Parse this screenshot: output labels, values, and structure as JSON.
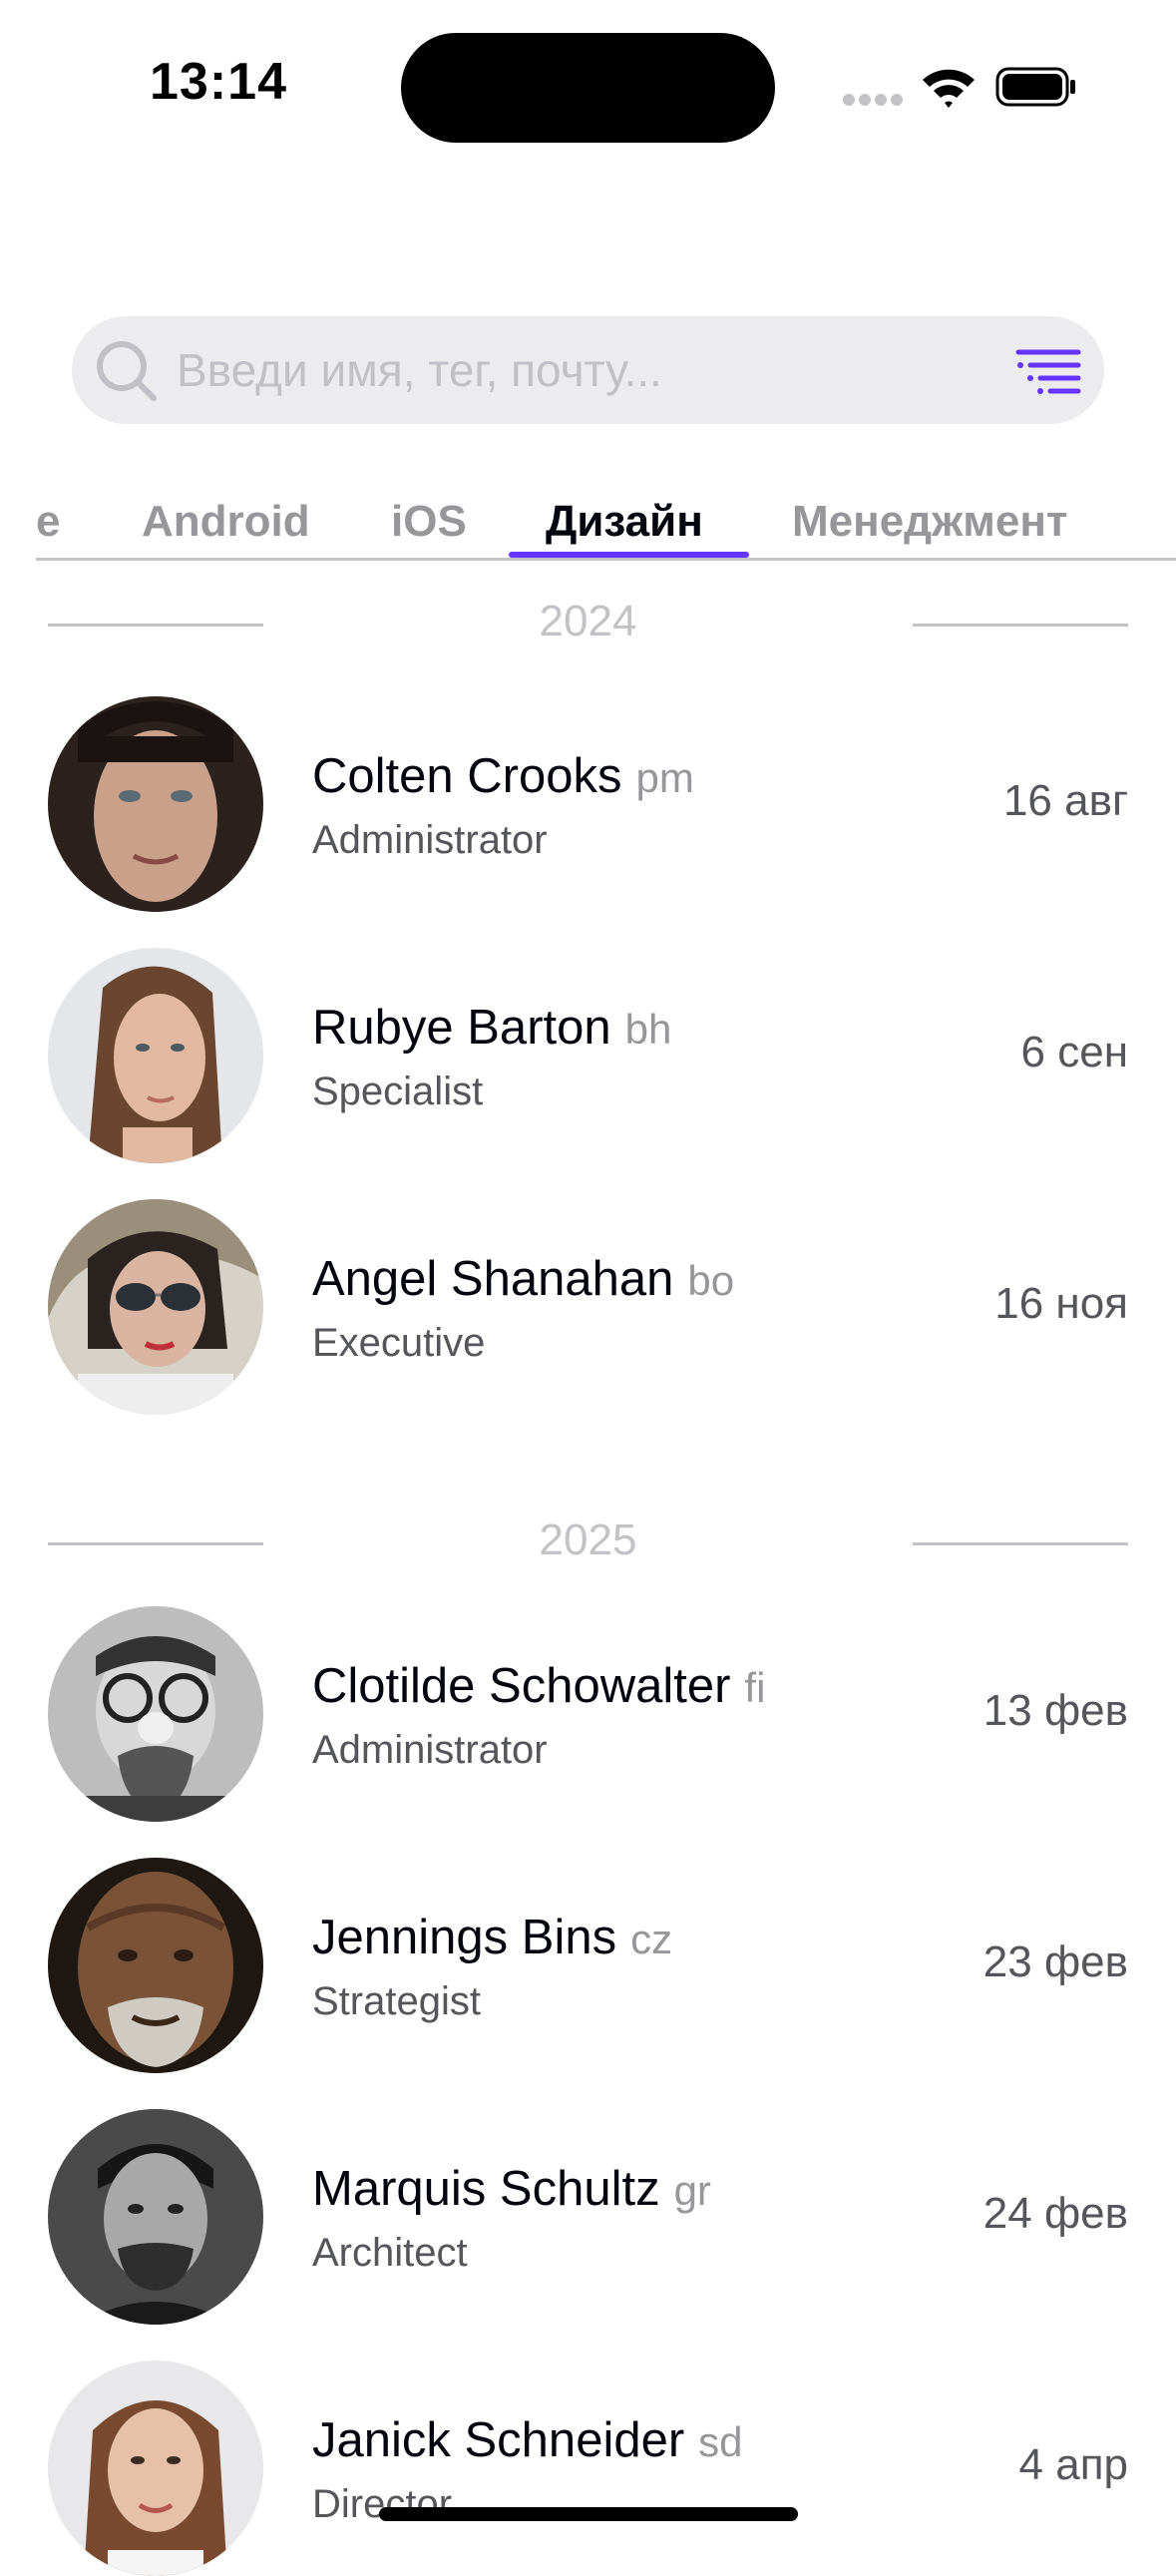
{
  "status_bar": {
    "time": "13:14"
  },
  "search": {
    "placeholder": "Введи имя, тег, почту...",
    "icon": "search-icon",
    "filter_icon": "filter-icon",
    "accent_color": "#6534ff"
  },
  "tabs": [
    {
      "label": "e",
      "active": false
    },
    {
      "label": "Android",
      "active": false
    },
    {
      "label": "iOS",
      "active": false
    },
    {
      "label": "Дизайн",
      "active": true
    },
    {
      "label": "Менеджмент",
      "active": false
    }
  ],
  "groups": [
    {
      "year": "2024",
      "people": [
        {
          "name": "Colten Crooks",
          "tag": "pm",
          "role": "Administrator",
          "date": "16 авг"
        },
        {
          "name": "Rubye Barton",
          "tag": "bh",
          "role": "Specialist",
          "date": "6 сен"
        },
        {
          "name": "Angel Shanahan",
          "tag": "bo",
          "role": "Executive",
          "date": "16 ноя"
        }
      ]
    },
    {
      "year": "2025",
      "people": [
        {
          "name": "Clotilde Schowalter",
          "tag": "fi",
          "role": "Administrator",
          "date": "13 фев"
        },
        {
          "name": "Jennings Bins",
          "tag": "cz",
          "role": "Strategist",
          "date": "23 фев"
        },
        {
          "name": "Marquis Schultz",
          "tag": "gr",
          "role": "Architect",
          "date": "24 фев"
        },
        {
          "name": "Janick Schneider",
          "tag": "sd",
          "role": "Director",
          "date": "4 апр"
        }
      ]
    }
  ]
}
